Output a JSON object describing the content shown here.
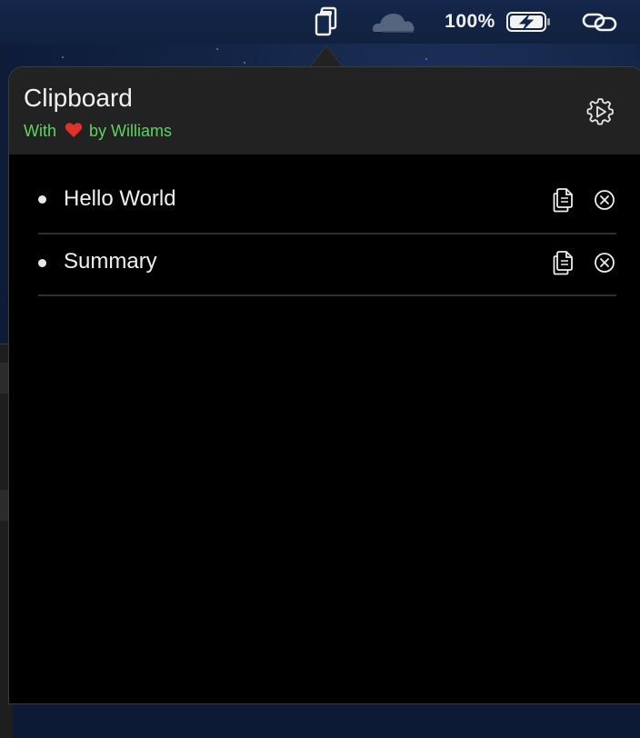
{
  "menubar": {
    "battery_percent": "100%",
    "icons": [
      "clipboard-icon",
      "cloud-icon",
      "battery-charging-icon",
      "link-icon"
    ]
  },
  "popover": {
    "title": "Clipboard",
    "subtitle_prefix": "With",
    "subtitle_heart_icon": "heart-icon",
    "subtitle_suffix": "by Williams",
    "settings_icon": "gear-icon",
    "accent_color": "#5ed35e"
  },
  "items": [
    {
      "text": "Hello World",
      "copy_icon": "copy-icon",
      "delete_icon": "close-circle-icon"
    },
    {
      "text": "Summary",
      "copy_icon": "copy-icon",
      "delete_icon": "close-circle-icon"
    }
  ]
}
